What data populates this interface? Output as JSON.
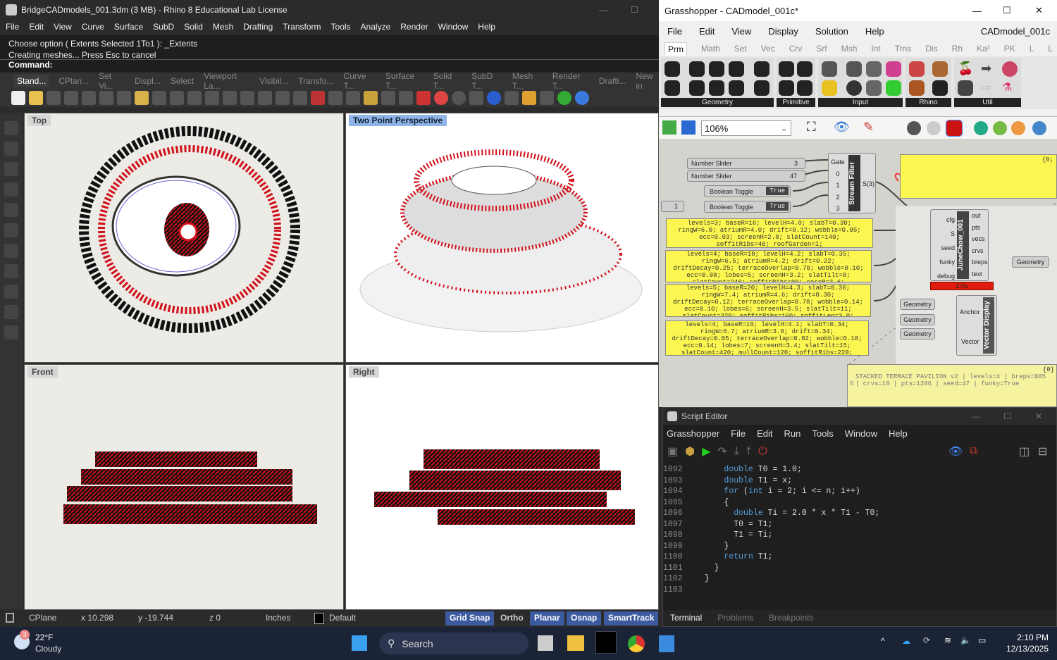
{
  "rhino": {
    "title": "BridgeCADmodels_001.3dm (3 MB) - Rhino 8 Educational Lab License",
    "menu": [
      "File",
      "Edit",
      "View",
      "Curve",
      "Surface",
      "SubD",
      "Solid",
      "Mesh",
      "Drafting",
      "Transform",
      "Tools",
      "Analyze",
      "Render",
      "Window",
      "Help"
    ],
    "history": [
      "Choose option ( Extents  Selected  1To1 ): _Extents",
      "Creating meshes... Press Esc to cancel"
    ],
    "command_prompt": "Command:",
    "toolbar_tabs": [
      "Stand...",
      "CPlan...",
      "Set Vi...",
      "Displ...",
      "Select",
      "Viewport La...",
      "Visibil...",
      "Transfo...",
      "Curve T...",
      "Surface T...",
      "Solid T...",
      "SubD T...",
      "Mesh T...",
      "Render T...",
      "Drafti...",
      "New in"
    ],
    "viewports": {
      "top": "Top",
      "perspective": "Two Point Perspective",
      "front": "Front",
      "right": "Right"
    },
    "status": {
      "cplane": "CPlane",
      "x": "x 10.298",
      "y": "y -19.744",
      "z": "z 0",
      "units": "Inches",
      "layer": "Default",
      "grid_snap": "Grid Snap",
      "ortho": "Ortho",
      "planar": "Planar",
      "osnap": "Osnap",
      "smarttrack": "SmartTrack"
    }
  },
  "grasshopper": {
    "title": "Grasshopper - CADmodel_001c*",
    "menu": [
      "File",
      "Edit",
      "View",
      "Display",
      "Solution",
      "Help"
    ],
    "doc_name": "CADmodel_001c",
    "tabs": [
      "Prm",
      "Math",
      "Set",
      "Vec",
      "Crv",
      "Srf",
      "Msh",
      "Int",
      "Trns",
      "Dis",
      "Rh",
      "Ka²",
      "PK",
      "L",
      "L",
      "D"
    ],
    "groups": [
      "Geometry",
      "Primitive",
      "Input",
      "Rhino",
      "Util"
    ],
    "zoom": "106%",
    "canvas": {
      "slider1": {
        "label": "Number Slider",
        "value": "3"
      },
      "slider2": {
        "label": "Number Slider",
        "value": "47"
      },
      "toggle1": {
        "label": "Boolean Toggle",
        "value": "True"
      },
      "toggle2": {
        "label": "Boolean Toggle",
        "value": "True"
      },
      "small_slider": "1",
      "stream_filter": {
        "name": "Stream Filter",
        "inputs": [
          "Gate",
          "0",
          "1",
          "2",
          "3"
        ],
        "output": "S(3)"
      },
      "panels": [
        "levels=3; baseR=16; levelH=4.0; slabT=0.30;\nringW=6.0; atriumR=4.0; drift=0.12; wobble=0.05;\necc=0.03; screenH=2.8; slatCount=140;\nsoffitRibs=40; roofGarden=1;",
        "levels=4; baseR=18; levelH=4.2; slabT=0.35;\nringW=6.5; atriumR=4.2; drift=0.22;\ndriftDecay=0.25; terraceOverlap=0.70; wobble=0.10;\necc=0.08; lobes=5; screenH=3.2; slatTilt=8;\nslatCount=240; soffitRibs=90; coreR=3.6;",
        "levels=5; baseR=20; levelH=4.3; slabT=0.36;\nringW=7.4; atriumR=4.6; drift=0.30;\ndriftDecay=0.12; terraceOverlap=0.78; wobble=0.14;\necc=0.10; lobes=6; screenH=3.5; slatTilt=11;\nslatCount=320; soffitRibs=160; soffitLen=3.0;",
        "levels=4; baseR=19; levelH=4.1; slabT=0.34;\nringW=6.7; atriumR=3.9; drift=0.34;\ndriftDecay=0.05; terraceOverlap=0.82; wobble=0.18;\necc=0.14; lobes=7; screenH=3.4; slatTilt=15;\nslatCount=420; mullCount=120; soffitRibs=220;"
      ],
      "top_panel_path": "{0;",
      "script": {
        "name": "JuneChow_001",
        "inputs": [
          "cfg",
          "S",
          "seed",
          "funky",
          "debug"
        ],
        "outputs": [
          "out",
          "pts",
          "vecs",
          "crvs",
          "breps",
          "text"
        ],
        "time": "2.0s"
      },
      "geometry_out": "Geometry",
      "geometry_params": [
        "Geometry",
        "Geometry",
        "Geometry"
      ],
      "vector_display": {
        "name": "Vector Display",
        "inputs": [
          "Anchor",
          "Vector"
        ]
      },
      "output_panel": {
        "path": "{0}",
        "index": "0",
        "text": "STACKED TERRACE PAVILION v2 | levels=4 | breps=885\n| crvs=18 | pts=1286 | seed=47 | funky=True"
      }
    }
  },
  "script_editor": {
    "title": "Script Editor",
    "menu": [
      "Grasshopper",
      "File",
      "Edit",
      "Run",
      "Tools",
      "Window",
      "Help"
    ],
    "code": [
      {
        "n": "1092",
        "t": "      double T0 = 1.0;"
      },
      {
        "n": "1093",
        "t": "      double T1 = x;"
      },
      {
        "n": "1094",
        "t": "      for (int i = 2; i <= n; i++)"
      },
      {
        "n": "1095",
        "t": "      {"
      },
      {
        "n": "1096",
        "t": "        double Ti = 2.0 * x * T1 - T0;"
      },
      {
        "n": "1097",
        "t": "        T0 = T1;"
      },
      {
        "n": "1098",
        "t": "        T1 = Ti;"
      },
      {
        "n": "1099",
        "t": "      }"
      },
      {
        "n": "1100",
        "t": "      return T1;"
      },
      {
        "n": "1101",
        "t": "    }"
      },
      {
        "n": "1102",
        "t": "  }"
      },
      {
        "n": "1103",
        "t": ""
      }
    ],
    "bottom_tabs": [
      "Terminal",
      "Problems",
      "Breakpoints"
    ]
  },
  "taskbar": {
    "temp": "22°F",
    "weather": "Cloudy",
    "badge": "3",
    "search": "Search",
    "time": "2:10 PM",
    "date": "12/13/2025"
  },
  "colors": {
    "model_red": "#d0101a",
    "snap_on": "#3c5aa0",
    "panel_yellow": "#fbf650",
    "taskbar": "#1b2437"
  }
}
